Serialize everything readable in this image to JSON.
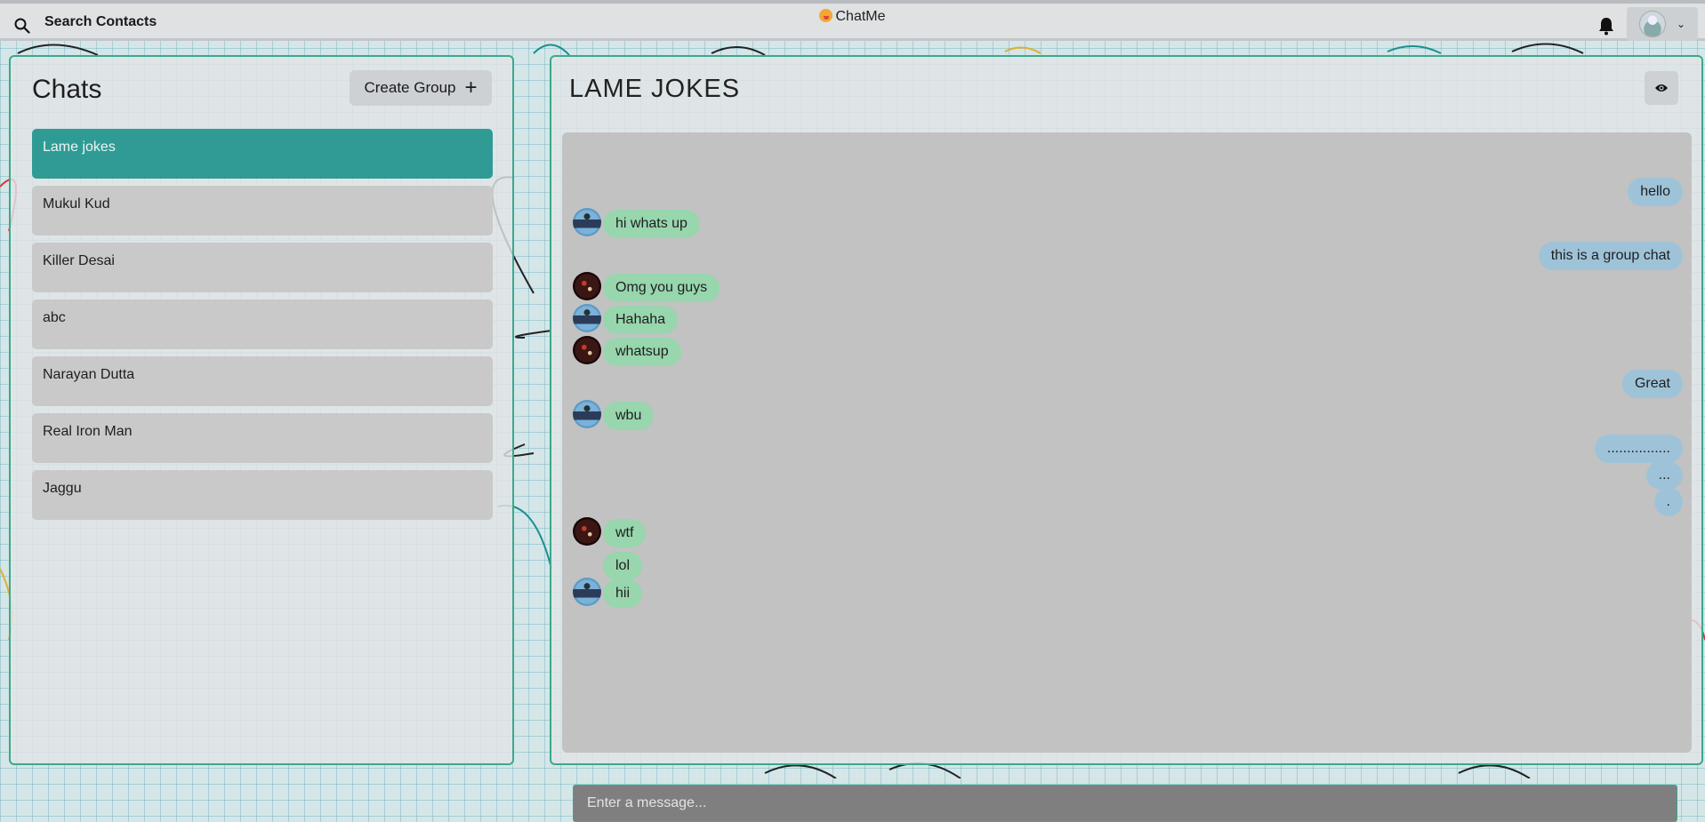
{
  "topbar": {
    "search_label": "Search Contacts",
    "brand": "ChatMe"
  },
  "sidebar": {
    "title": "Chats",
    "create_group_label": "Create Group",
    "chats": [
      {
        "name": "Lame jokes",
        "active": true
      },
      {
        "name": "Mukul Kud",
        "active": false
      },
      {
        "name": "Killer Desai",
        "active": false
      },
      {
        "name": "abc",
        "active": false
      },
      {
        "name": "Narayan Dutta",
        "active": false
      },
      {
        "name": "Real Iron Man",
        "active": false
      },
      {
        "name": "Jaggu",
        "active": false
      }
    ]
  },
  "chat": {
    "title": "LAME JOKES",
    "input_placeholder": "Enter a message...",
    "messages": [
      {
        "text": "hello",
        "from": "me"
      },
      {
        "text": "hi whats up",
        "from": "other",
        "avatar": "blue"
      },
      {
        "text": "this is a group chat",
        "from": "me"
      },
      {
        "text": "Omg you guys",
        "from": "other",
        "avatar": "dark"
      },
      {
        "text": "Hahaha",
        "from": "other",
        "avatar": "blue"
      },
      {
        "text": "whatsup",
        "from": "other",
        "avatar": "dark"
      },
      {
        "text": "Great",
        "from": "me"
      },
      {
        "text": "wbu",
        "from": "other",
        "avatar": "blue"
      },
      {
        "text": "................",
        "from": "me"
      },
      {
        "text": "...",
        "from": "me"
      },
      {
        "text": ".",
        "from": "me"
      },
      {
        "text": "wtf",
        "from": "other",
        "avatar": "dark"
      },
      {
        "text": "lol",
        "from": "other",
        "avatar": "none"
      },
      {
        "text": "hii",
        "from": "other",
        "avatar": "blue"
      }
    ]
  },
  "colors": {
    "accent": "#2f9b94",
    "incoming_bubble": "#98d6ad",
    "outgoing_bubble": "#9ec3d9",
    "panel_border": "#3aa98c"
  }
}
